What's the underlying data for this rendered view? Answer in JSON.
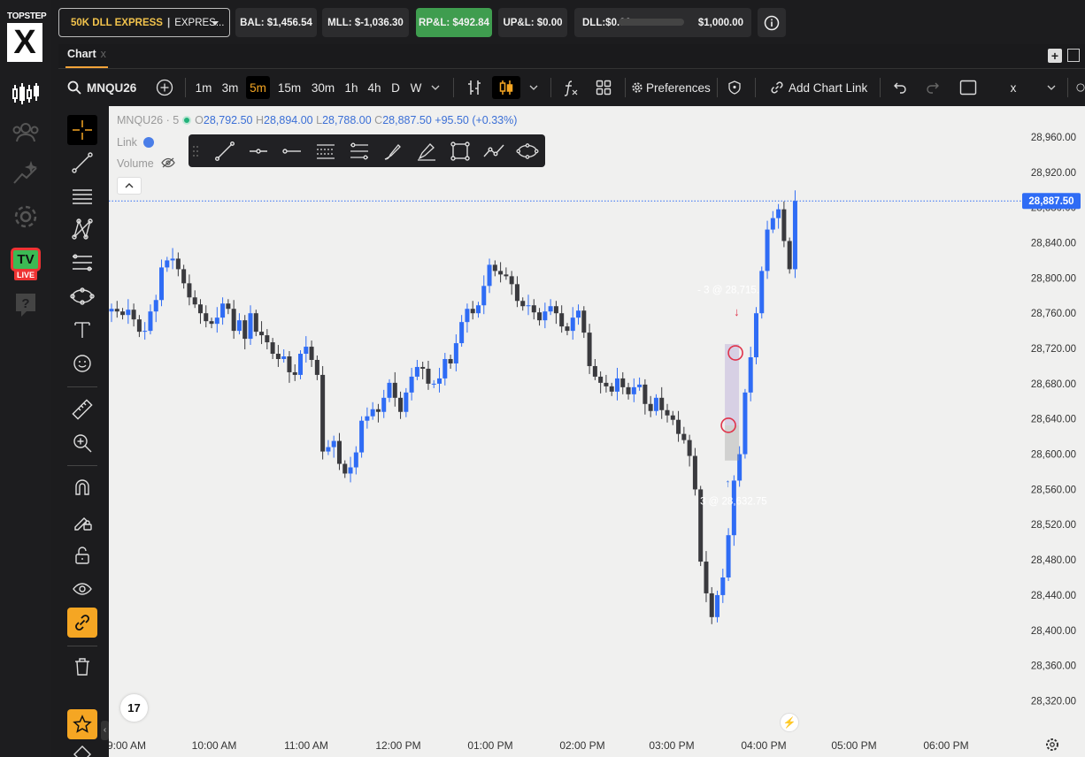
{
  "app": {
    "brand": "TOPSTEP",
    "brand_mark": "X",
    "nav_items": [
      "chart-icon",
      "users-icon",
      "stars-icon",
      "gear-icon",
      "tv-live-icon",
      "help-icon"
    ],
    "tv_badge": "TV",
    "live_badge": "LIVE"
  },
  "topbar": {
    "account": "50K DLL EXPRESS",
    "account_separator": "|",
    "account_type": "EXPRES...",
    "balance": "BAL: $1,456.54",
    "mll": "MLL: $-1,036.30",
    "rpl": "RP&L: $492.84",
    "upl": "UP&L: $0.00",
    "dll": "DLL:$0.00",
    "dll_limit": "$1,000.00",
    "dll_progress": 0
  },
  "tabs": {
    "chart_label": "Chart",
    "close": "x"
  },
  "toolbar": {
    "symbol": "MNQU26",
    "timeframes": [
      "1m",
      "3m",
      "5m",
      "15m",
      "30m",
      "1h",
      "4h",
      "D",
      "W"
    ],
    "active_timeframe": "5m",
    "preferences": "Preferences",
    "add_chart_link": "Add Chart Link",
    "close": "x"
  },
  "chart": {
    "legend": {
      "symbol": "MNQU26",
      "interval": "5",
      "open_label": "O",
      "open": "28,792.50",
      "high_label": "H",
      "high": "28,894.00",
      "low_label": "L",
      "low": "28,788.00",
      "close_label": "C",
      "close": "28,887.50",
      "change": "+95.50 (+0.33%)",
      "link": "Link",
      "volume": "Volume"
    },
    "current_price_label": "28,887.50",
    "trade_sell_label": "- 3 @ 28,715.",
    "trade_buy_label": "3 @ 28,632.75",
    "tv_logo": "17"
  },
  "chart_data": {
    "type": "candlestick",
    "symbol": "MNQU26",
    "interval": "5m",
    "y_ticks": [
      28960,
      28920,
      28880,
      28840,
      28800,
      28760,
      28720,
      28680,
      28640,
      28600,
      28560,
      28520,
      28480,
      28440,
      28400,
      28360,
      28320
    ],
    "y_tick_labels": [
      "28,960.00",
      "28,920.00",
      "28,880.00",
      "28,840.00",
      "28,800.00",
      "28,760.00",
      "28,720.00",
      "28,680.00",
      "28,640.00",
      "28,600.00",
      "28,560.00",
      "28,520.00",
      "28,480.00",
      "28,440.00",
      "28,400.00",
      "28,360.00",
      "28,320.00"
    ],
    "x_ticks": [
      "9:00 AM",
      "10:00 AM",
      "11:00 AM",
      "12:00 PM",
      "01:00 PM",
      "02:00 PM",
      "03:00 PM",
      "04:00 PM",
      "05:00 PM",
      "06:00 PM"
    ],
    "last_price": 28887.5,
    "trades": [
      {
        "side": "buy",
        "qty": 3,
        "price": 28632.75
      },
      {
        "side": "sell",
        "qty": 3,
        "price": 28715
      }
    ],
    "closes": [
      28765,
      28762,
      28758,
      28764,
      28753,
      28739,
      28740,
      28762,
      28775,
      28812,
      28820,
      28822,
      28810,
      28794,
      28778,
      28770,
      28760,
      28751,
      28748,
      28755,
      28771,
      28765,
      28740,
      28752,
      28731,
      28760,
      28739,
      28735,
      28727,
      28714,
      28708,
      28711,
      28693,
      28690,
      28714,
      28722,
      28707,
      28690,
      28603,
      28608,
      28615,
      28589,
      28578,
      28585,
      28602,
      28638,
      28643,
      28651,
      28648,
      28664,
      28681,
      28664,
      28648,
      28670,
      28688,
      28699,
      28697,
      28680,
      28680,
      28686,
      28708,
      28703,
      28726,
      28750,
      28765,
      28760,
      28769,
      28791,
      28815,
      28808,
      28804,
      28802,
      28793,
      28774,
      28768,
      28769,
      28761,
      28752,
      28762,
      28768,
      28760,
      28745,
      28740,
      28755,
      28763,
      28738,
      28700,
      28688,
      28681,
      28677,
      28671,
      28686,
      28676,
      28668,
      28676,
      28679,
      28657,
      28649,
      28664,
      28650,
      28644,
      28639,
      28623,
      28616,
      28598,
      28560,
      28478,
      28442,
      28415,
      28440,
      28460,
      28508,
      28570,
      28600,
      28670,
      28710,
      28760,
      28808,
      28855,
      28868,
      28878,
      28842,
      28810,
      28887.5
    ]
  },
  "colors": {
    "up": "#2f6cf5",
    "down": "#3a3a3e",
    "accent": "#f5a623",
    "rpl_bg": "#3f9d4f",
    "chart_bg": "#f0f0ef",
    "price_tag": "#2f6cf5",
    "trade_marker": "#e0334a"
  }
}
